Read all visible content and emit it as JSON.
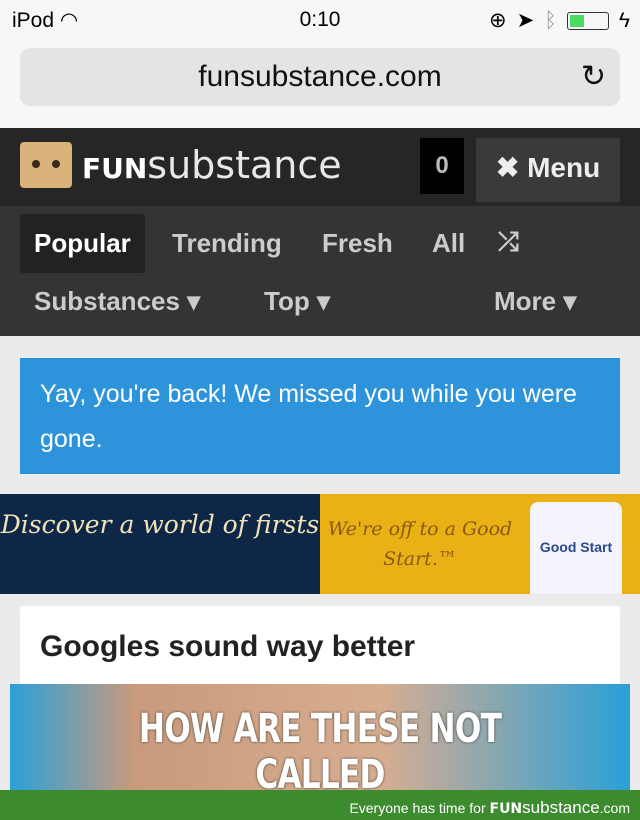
{
  "status": {
    "device": "iPod",
    "time": "0:10",
    "battery_level": 0.4
  },
  "browser": {
    "url": "funsubstance.com"
  },
  "header": {
    "brand_bold": "FUN",
    "brand_rest": "substance",
    "count": "0",
    "menu_label": "Menu"
  },
  "nav": {
    "items": [
      "Popular",
      "Trending",
      "Fresh",
      "All"
    ],
    "dropdowns": [
      "Substances",
      "Top",
      "More"
    ]
  },
  "alert": {
    "text": "Yay, you're back! We missed you while you were gone."
  },
  "ad": {
    "left_text": "Discover a world of firsts",
    "right_text": "We're off to a Good Start.™",
    "product": "Good Start"
  },
  "post": {
    "title": "Googles sound way better",
    "image_caption": "HOW ARE THESE NOT CALLED"
  },
  "footer": {
    "text": "Everyone has time for",
    "brand_bold": "FUN",
    "brand_rest": "substance",
    "domain": ".com"
  }
}
